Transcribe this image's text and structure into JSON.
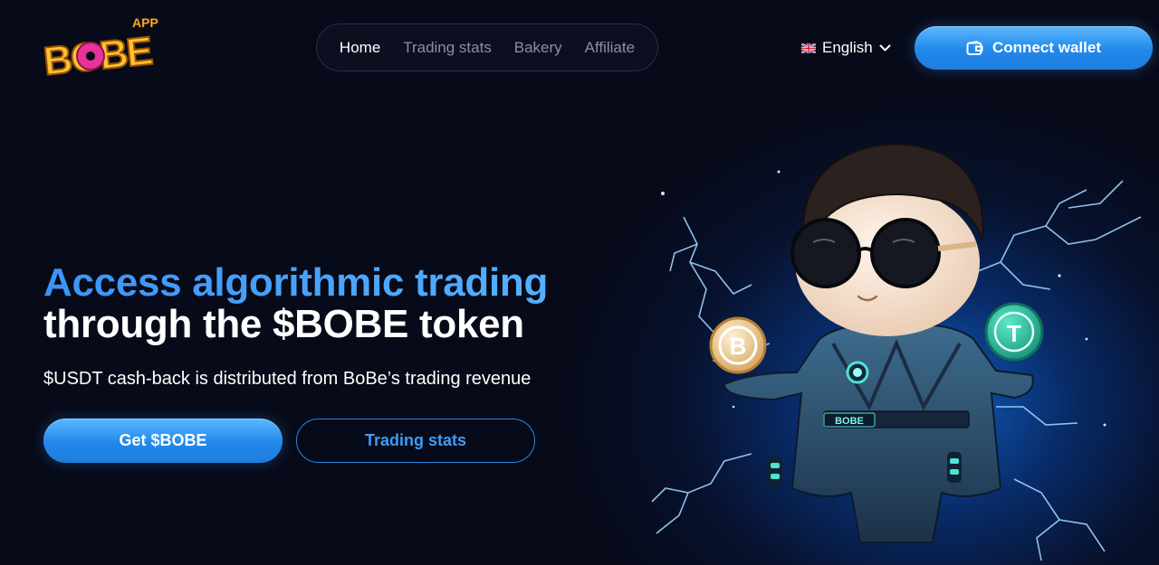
{
  "logo": {
    "top_text": "APP",
    "main_text": "BOBE"
  },
  "nav": {
    "items": [
      {
        "label": "Home",
        "active": true
      },
      {
        "label": "Trading stats",
        "active": false
      },
      {
        "label": "Bakery",
        "active": false
      },
      {
        "label": "Affiliate",
        "active": false
      }
    ]
  },
  "language": {
    "label": "English",
    "flag_icon": "uk-flag-icon"
  },
  "connect_wallet": {
    "label": "Connect wallet",
    "icon": "wallet-icon"
  },
  "hero": {
    "headline_line1": "Access algorithmic trading",
    "headline_line2": "through the $BOBE token",
    "subtitle": "$USDT cash-back is distributed from BoBe’s trading revenue",
    "primary_button": "Get $BOBE",
    "secondary_button": "Trading stats"
  },
  "illustration": {
    "belt_text": "BOBE",
    "left_coin_symbol": "B",
    "right_coin_symbol": "T"
  },
  "colors": {
    "background": "#070a18",
    "accent_blue": "#2188ea",
    "headline_blue": "#3b94f5",
    "nav_inactive": "#8a8fa3",
    "logo_yellow": "#ffc233",
    "logo_pink": "#e8349a"
  }
}
